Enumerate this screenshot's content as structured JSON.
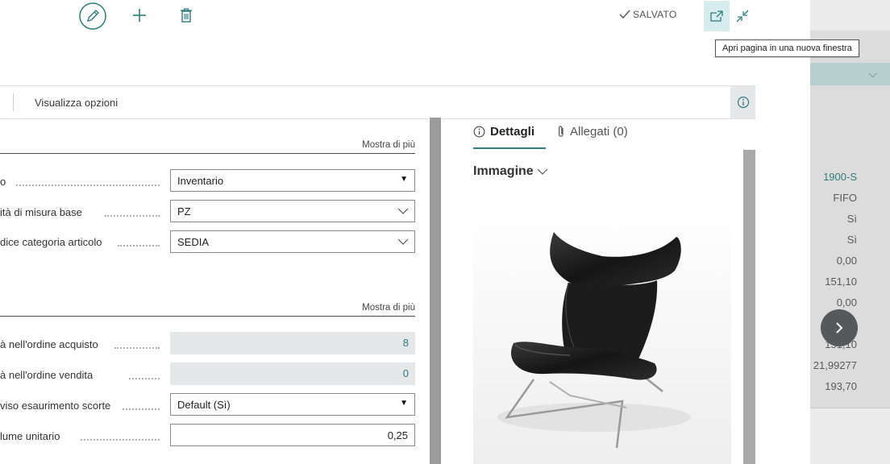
{
  "toolbar": {
    "edit_icon": "pencil-icon",
    "new_icon": "plus-icon",
    "delete_icon": "trash-icon",
    "saved_label": "SALVATO",
    "tooltip": "Apri pagina in una nuova finestra"
  },
  "options_bar": {
    "label": "Visualizza opzioni"
  },
  "sections": [
    {
      "show_more": "Mostra di più"
    },
    {
      "show_more": "Mostra di più"
    }
  ],
  "fields": [
    {
      "label": "o",
      "value": "Inventario",
      "kind": "select"
    },
    {
      "label": "ità di misura base",
      "value": "PZ",
      "kind": "lookup"
    },
    {
      "label": "dice categoria articolo",
      "value": "SEDIA",
      "kind": "lookup"
    },
    {
      "label": "à nell'ordine acquisto",
      "value": "8",
      "kind": "readonly"
    },
    {
      "label": "à nell'ordine vendita",
      "value": "0",
      "kind": "readonly"
    },
    {
      "label": "viso esaurimento scorte",
      "value": "Default (Sì)",
      "kind": "select"
    },
    {
      "label": "lume unitario",
      "value": "0,25",
      "kind": "number"
    }
  ],
  "factbox": {
    "tabs": [
      {
        "label": "Dettagli",
        "icon": "info-icon",
        "active": true
      },
      {
        "label": "Allegati (0)",
        "icon": "paperclip-icon",
        "active": false
      }
    ],
    "image_title": "Immagine",
    "image_alt": "chair-image"
  },
  "background_values": [
    "1900-S",
    "FIFO",
    "Sì",
    "Sì",
    "0,00",
    "151,10",
    "0,00",
    "151,10",
    "21,99277",
    "193,70"
  ],
  "colors": {
    "accent": "#2f7c7c",
    "readonly_bg": "#e5e7e8",
    "popout_highlight": "#d6ecee"
  }
}
